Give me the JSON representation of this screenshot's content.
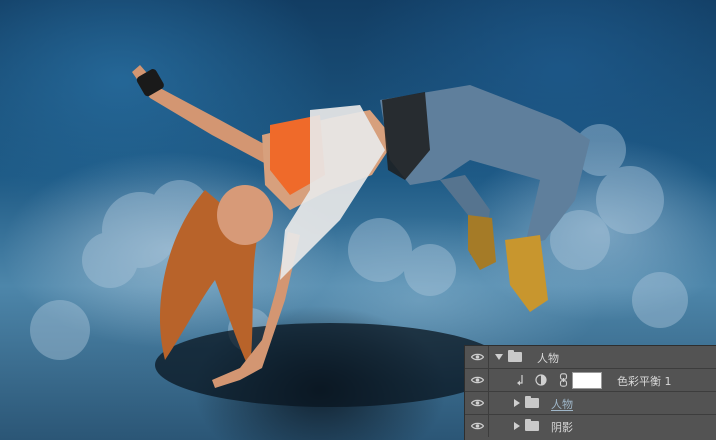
{
  "layers_panel": {
    "layers": [
      {
        "name": "人物",
        "type": "group",
        "expanded": true,
        "visible": true
      },
      {
        "name": "色彩平衡 1",
        "type": "adjustment",
        "clipped": true,
        "visible": true
      },
      {
        "name": "人物",
        "type": "group",
        "expanded": false,
        "visible": true,
        "underlined": true
      },
      {
        "name": "阴影",
        "type": "group",
        "expanded": false,
        "visible": true
      }
    ]
  },
  "colors": {
    "panel_bg": "#535353",
    "panel_border": "#3d3d3d",
    "text": "#d8d8d8",
    "underline_text": "#9fb6c8"
  }
}
